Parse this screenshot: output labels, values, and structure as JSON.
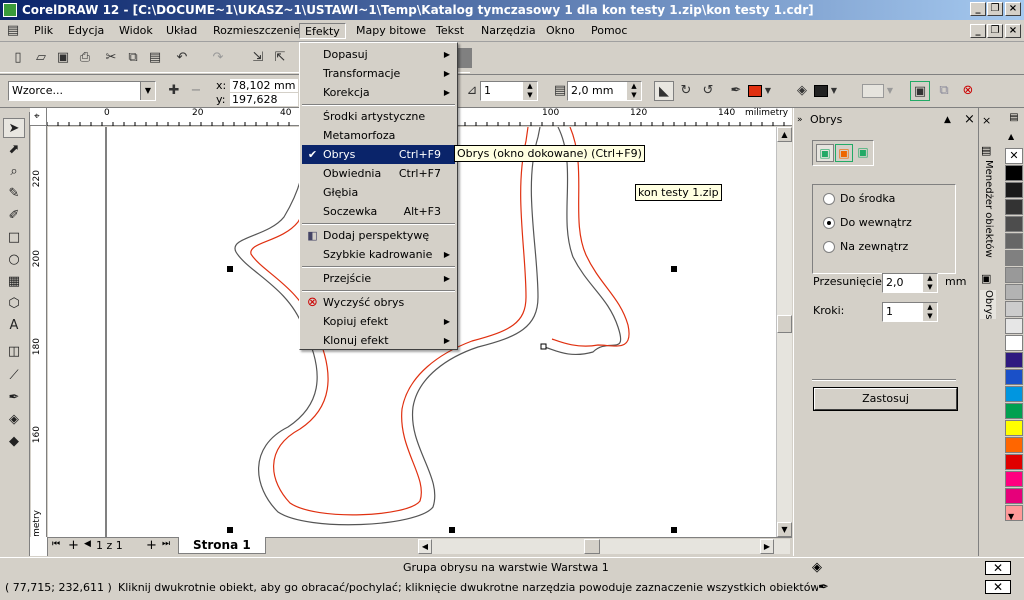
{
  "window": {
    "title": "CorelDRAW 12 - [C:\\DOCUME~1\\UKASZ~1\\USTAWI~1\\Temp\\Katalog tymczasowy 1 dla kon testy 1.zip\\kon testy 1.cdr]"
  },
  "menu": [
    "Plik",
    "Edycja",
    "Widok",
    "Układ",
    "Rozmieszczenie",
    "Efekty",
    "Mapy bitowe",
    "Tekst",
    "Narzędzia",
    "Okno",
    "Pomoc"
  ],
  "propbar": {
    "preset": "Wzorce...",
    "x": "78,102 mm",
    "y": "197,628 mm",
    "x_label": "x:",
    "y_label": "y:",
    "steps": "1",
    "offset": "2,0 mm"
  },
  "rulers": {
    "h": [
      "0",
      "20",
      "40",
      "100",
      "120",
      "140"
    ],
    "h_unit": "milimetry",
    "v": [
      "220",
      "200",
      "180",
      "160"
    ],
    "v_unit": "milimetry"
  },
  "effects_menu": {
    "items": [
      {
        "label": "Dopasuj",
        "shortcut": "",
        "sub": true
      },
      {
        "label": "Transformacje",
        "shortcut": "",
        "sub": true
      },
      {
        "label": "Korekcja",
        "shortcut": "",
        "sub": true
      },
      {
        "label": "Środki artystyczne",
        "shortcut": "",
        "sub": false
      },
      {
        "label": "Metamorfoza",
        "shortcut": "",
        "sub": false
      },
      {
        "label": "Obrys",
        "shortcut": "Ctrl+F9",
        "sub": false
      },
      {
        "label": "Obwiednia",
        "shortcut": "Ctrl+F7",
        "sub": false
      },
      {
        "label": "Głębia",
        "shortcut": "",
        "sub": false
      },
      {
        "label": "Soczewka",
        "shortcut": "Alt+F3",
        "sub": false
      },
      {
        "label": "Dodaj perspektywę",
        "shortcut": "",
        "sub": false
      },
      {
        "label": "Szybkie kadrowanie",
        "shortcut": "",
        "sub": true
      },
      {
        "label": "Przejście",
        "shortcut": "",
        "sub": true
      },
      {
        "label": "Wyczyść obrys",
        "shortcut": "",
        "sub": false
      },
      {
        "label": "Kopiuj efekt",
        "shortcut": "",
        "sub": true
      },
      {
        "label": "Klonuj efekt",
        "shortcut": "",
        "sub": true
      }
    ],
    "tooltip": "Obrys (okno dokowane) (Ctrl+F9)"
  },
  "canvas_tooltip": "kon testy 1.zip",
  "page_nav": {
    "counter": "1 z 1",
    "tab": "Strona 1"
  },
  "docker": {
    "title": "Obrys",
    "radio": [
      "Do środka",
      "Do wewnątrz",
      "Na zewnątrz"
    ],
    "selected": 1,
    "offset_label": "Przesunięcie:",
    "offset_value": "2,0",
    "offset_unit": "mm",
    "steps_label": "Kroki:",
    "steps_value": "1",
    "apply": "Zastosuj"
  },
  "docker_tabs": [
    "Menedżer obiektów",
    "Obrys"
  ],
  "palette": [
    "#ffffff",
    "#000000",
    "#1a1a1a",
    "#333333",
    "#4d4d4d",
    "#666666",
    "#808080",
    "#999999",
    "#b3b3b3",
    "#cccccc",
    "#e6e6e6",
    "#ffffff",
    "#2e1a80",
    "#1a50c8",
    "#0096e0",
    "#00a050",
    "#ffff00",
    "#ff6600",
    "#e00000",
    "#ff0080",
    "#e6007a",
    "#ff9999"
  ],
  "status": {
    "object": "Grupa obrysu na warstwie Warstwa 1",
    "coords": "( 77,715; 232,611 )",
    "hint": "Kliknij dwukrotnie obiekt, aby go obracać/pochylać; kliknięcie dwukrotne narzędzia powoduje zaznaczenie wszystkich obiektów; kliknięcie z przy..."
  },
  "colors": {
    "fill": "#e03010",
    "outline": "#222222"
  }
}
